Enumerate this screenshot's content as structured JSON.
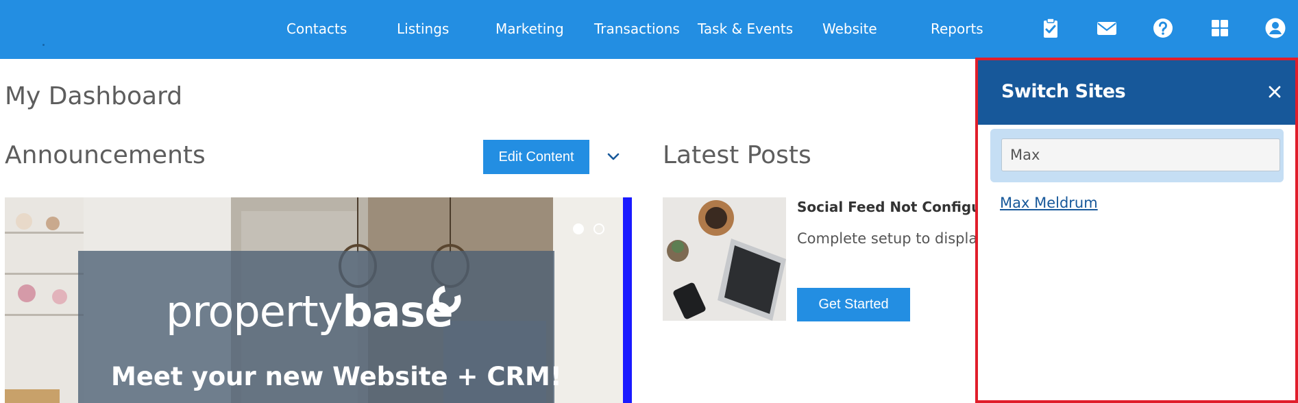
{
  "nav": {
    "links": [
      "Contacts",
      "Listings",
      "Marketing",
      "Transactions",
      "Task & Events",
      "Website",
      "Reports"
    ],
    "icons": [
      "clipboard-check-icon",
      "envelope-icon",
      "question-circle-icon",
      "grid-apps-icon",
      "user-circle-icon"
    ],
    "color": "#238ee2"
  },
  "page": {
    "title": "My Dashboard"
  },
  "announcements": {
    "title": "Announcements",
    "edit_button": "Edit Content",
    "carousel": {
      "brand_light": "property",
      "brand_bold": "base",
      "tagline": "Meet your new Website + CRM!",
      "slides": 2,
      "active_slide": 1
    }
  },
  "posts": {
    "title": "Latest Posts",
    "item": {
      "heading": "Social Feed Not Configured",
      "body": "Complete setup to display",
      "button": "Get Started"
    }
  },
  "switch_sites": {
    "title": "Switch Sites",
    "search_value": "Max",
    "results": [
      "Max Meldrum"
    ],
    "header_color": "#17589a",
    "border_color": "#e01e2b"
  }
}
